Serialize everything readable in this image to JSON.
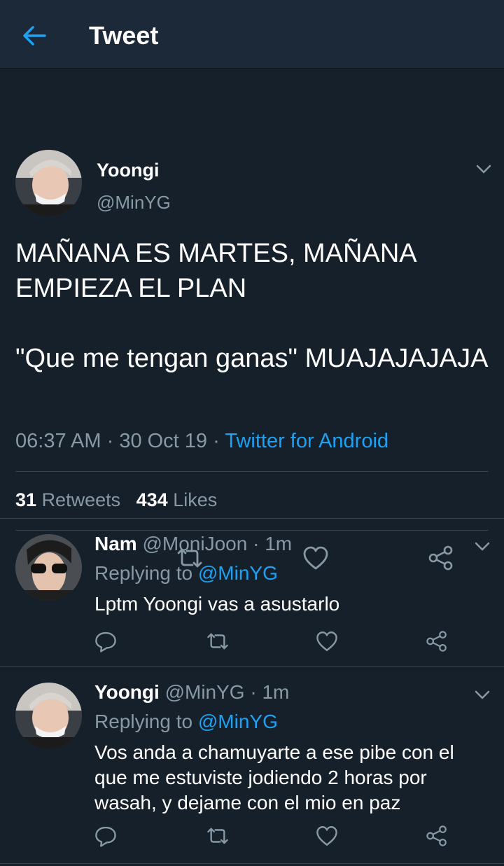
{
  "header": {
    "title": "Tweet",
    "back_icon": "arrow-left-icon",
    "accent": "#1da1f2"
  },
  "tweet": {
    "name": "Yoongi",
    "handle": "@MinYG",
    "text": "MAÑANA ES MARTES, MAÑANA EMPIEZA EL PLAN\n\n\"Que me tengan ganas\" MUAJAJAJAJA",
    "time": "06:37 AM",
    "date": "30 Oct 19",
    "source": "Twitter for Android",
    "retweets_count": "31",
    "retweets_label": "Retweets",
    "likes_count": "434",
    "likes_label": "Likes"
  },
  "replies": [
    {
      "name": "Nam",
      "handle": "@MoniJoon",
      "time": "1m",
      "replying_label": "Replying to",
      "replying_to": "@MinYG",
      "text": "Lptm Yoongi vas a asustarlo"
    },
    {
      "name": "Yoongi",
      "handle": "@MinYG",
      "time": "1m",
      "replying_label": "Replying to",
      "replying_to": "@MinYG",
      "text": "Vos anda a chamuyarte a ese pibe con el que me estuviste jodiendo 2 horas por wasah, y dejame con el mio en paz"
    }
  ],
  "colors": {
    "background": "#15202b",
    "header": "#1c2938",
    "secondary_text": "#8899a6",
    "divider": "#38444d"
  }
}
